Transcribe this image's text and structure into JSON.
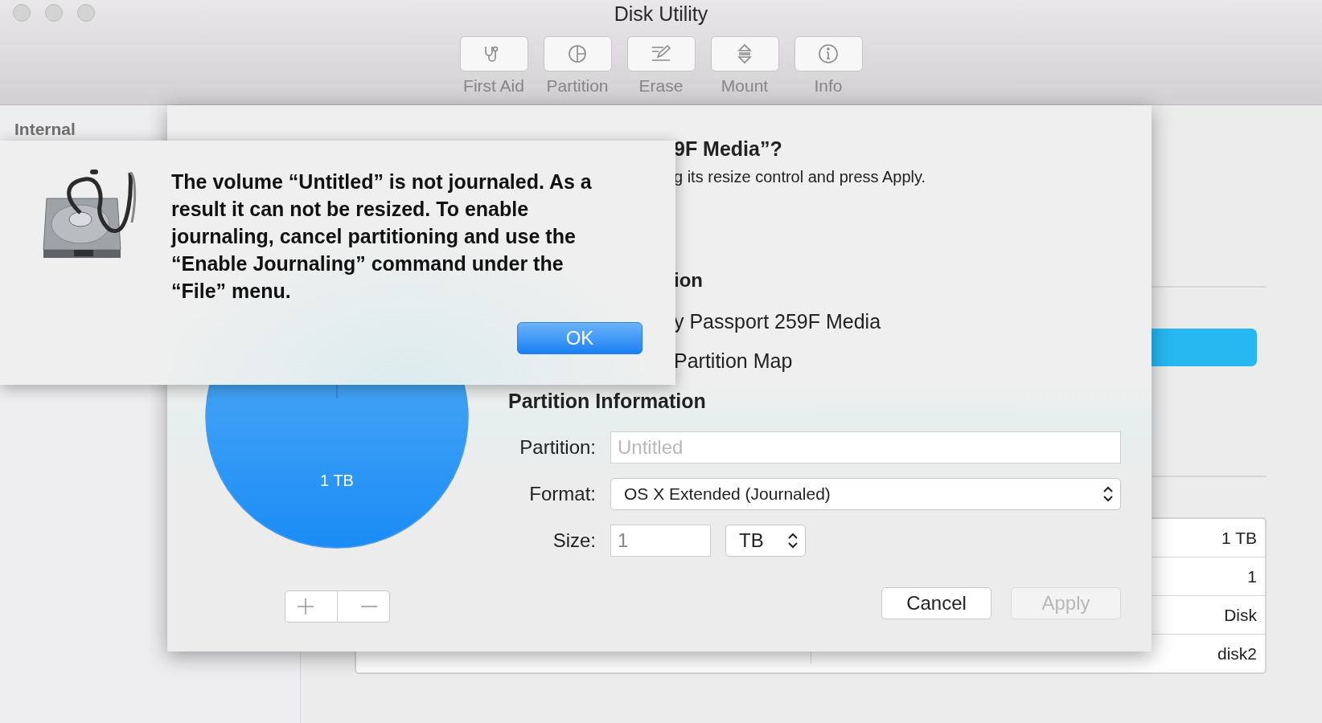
{
  "window": {
    "title": "Disk Utility"
  },
  "toolbar": [
    {
      "label": "First Aid"
    },
    {
      "label": "Partition"
    },
    {
      "label": "Erase"
    },
    {
      "label": "Mount"
    },
    {
      "label": "Info"
    }
  ],
  "sidebar": {
    "section": "Internal"
  },
  "info_table": {
    "rows": [
      {
        "right_value": "1 TB"
      },
      {
        "right_value": "1"
      },
      {
        "right_value": "Disk"
      },
      {
        "right_value": "disk2"
      }
    ]
  },
  "partition_sheet": {
    "title": "9F Media”?",
    "subtitle": "g its resize control and press Apply.",
    "device_heading": "ion",
    "device_name": "y Passport 259F Media",
    "scheme": "Partition Map",
    "pie_label": "1 TB",
    "info_heading": "Partition Information",
    "fields": [
      {
        "label": "Partition:",
        "kind": "text",
        "placeholder": "Untitled"
      },
      {
        "label": "Format:",
        "kind": "select",
        "value": "OS X Extended (Journaled)"
      },
      {
        "label": "Size:",
        "kind": "size",
        "value": "1",
        "unit": "TB"
      }
    ],
    "buttons": [
      {
        "label": "Cancel",
        "disabled": false
      },
      {
        "label": "Apply",
        "disabled": true
      }
    ]
  },
  "alert": {
    "message": "The volume “Untitled” is not journaled. As a result it can not be resized. To enable journaling, cancel partitioning and use the “Enable Journaling” command under the “File” menu.",
    "button": "OK"
  }
}
